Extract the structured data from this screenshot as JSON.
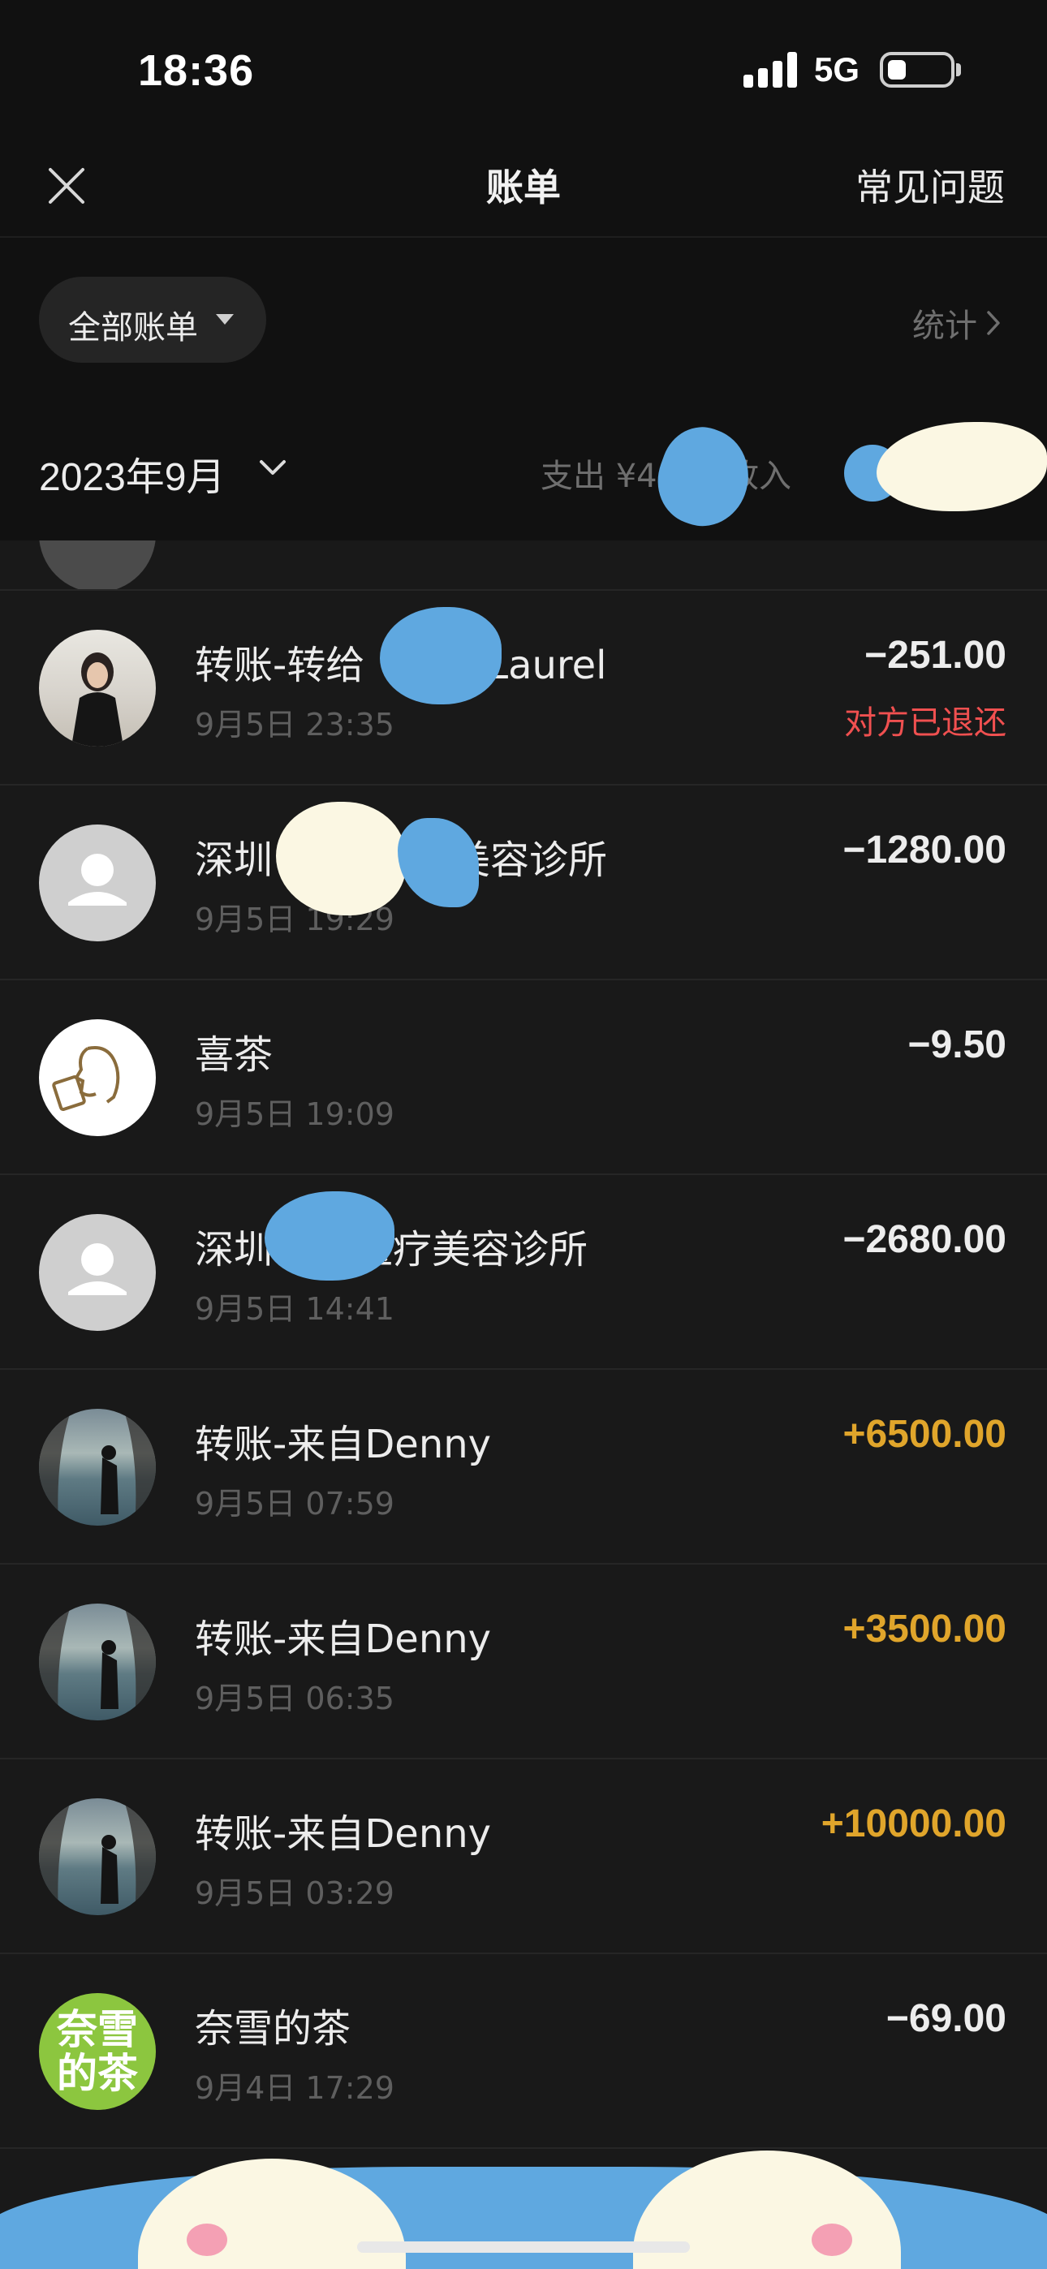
{
  "status_bar": {
    "time": "18:36",
    "network": "5G"
  },
  "nav": {
    "title": "账单",
    "faq_label": "常见问题"
  },
  "filter": {
    "label": "全部账单",
    "stats_label": "统计"
  },
  "month": {
    "label": "2023年9月",
    "expense_label": "支出 ¥46",
    "income_label": "收入"
  },
  "transactions": [
    {
      "title": "转账-转给",
      "title_suffix": "Laurel",
      "time": "9月5日 23:35",
      "amount": "−251.00",
      "type": "expense",
      "status": "对方已退还",
      "avatar": "photo-person"
    },
    {
      "title": "深圳",
      "title_suffix": "美容诊所",
      "time": "9月5日 19:29",
      "amount": "−1280.00",
      "type": "expense",
      "status": "",
      "avatar": "default-person"
    },
    {
      "title": "喜茶",
      "title_suffix": "",
      "time": "9月5日 19:09",
      "amount": "−9.50",
      "type": "expense",
      "status": "",
      "avatar": "heytea-logo"
    },
    {
      "title": "深圳",
      "title_suffix": "医疗美容诊所",
      "time": "9月5日 14:41",
      "amount": "−2680.00",
      "type": "expense",
      "status": "",
      "avatar": "default-person"
    },
    {
      "title": "转账-来自Denny",
      "title_suffix": "",
      "time": "9月5日 07:59",
      "amount": "+6500.00",
      "type": "income",
      "status": "",
      "avatar": "photo-landscape"
    },
    {
      "title": "转账-来自Denny",
      "title_suffix": "",
      "time": "9月5日 06:35",
      "amount": "+3500.00",
      "type": "income",
      "status": "",
      "avatar": "photo-landscape"
    },
    {
      "title": "转账-来自Denny",
      "title_suffix": "",
      "time": "9月5日 03:29",
      "amount": "+10000.00",
      "type": "income",
      "status": "",
      "avatar": "photo-landscape"
    },
    {
      "title": "奈雪的茶",
      "title_suffix": "",
      "time": "9月4日 17:29",
      "amount": "−69.00",
      "type": "expense",
      "status": "",
      "avatar": "nayuki-logo",
      "avatar_text": "奈雪的茶"
    }
  ],
  "colors": {
    "background": "#191919",
    "header": "#111111",
    "income": "#e0a52b",
    "refund": "#f05050",
    "redaction": "#5fa8e0"
  }
}
